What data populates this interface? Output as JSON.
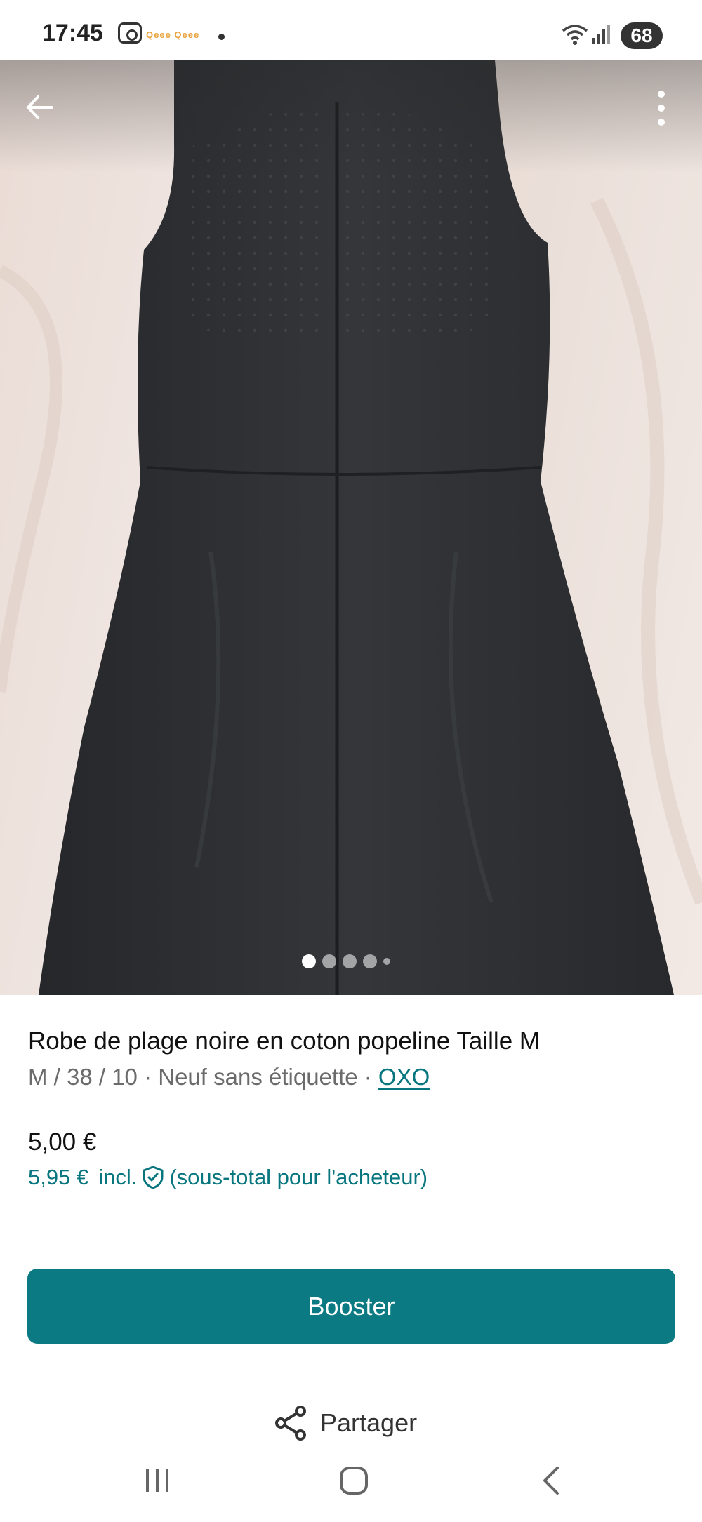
{
  "status_bar": {
    "time": "17:45",
    "apps_text": "Qeee Qeee",
    "battery": "68",
    "icons": [
      "camera-icon",
      "notification-dot",
      "wifi-icon",
      "signal-icon",
      "battery-icon"
    ]
  },
  "photo": {
    "icons": [
      "back-arrow-icon",
      "more-vert-icon"
    ],
    "page_indicator": {
      "total_visible": 5,
      "active_index": 0
    }
  },
  "product": {
    "title": "Robe de plage noire en coton popeline Taille M",
    "subtitle_prefix": "M / 38 / 10 · Neuf sans étiquette · ",
    "brand": "OXO",
    "price": "5,00 €",
    "buyer_price": "5,95 €",
    "buyer_incl": "incl.",
    "buyer_note": "(sous-total pour l'acheteur)"
  },
  "actions": {
    "booster_label": "Booster",
    "share_label": "Partager"
  },
  "navbar": {
    "icons": [
      "recents-icon",
      "home-icon",
      "back-icon"
    ]
  },
  "colors": {
    "accent": "#0b7a83",
    "link": "#08767f",
    "dress": "#2e3033",
    "background_fabric": "#ede2dc"
  }
}
